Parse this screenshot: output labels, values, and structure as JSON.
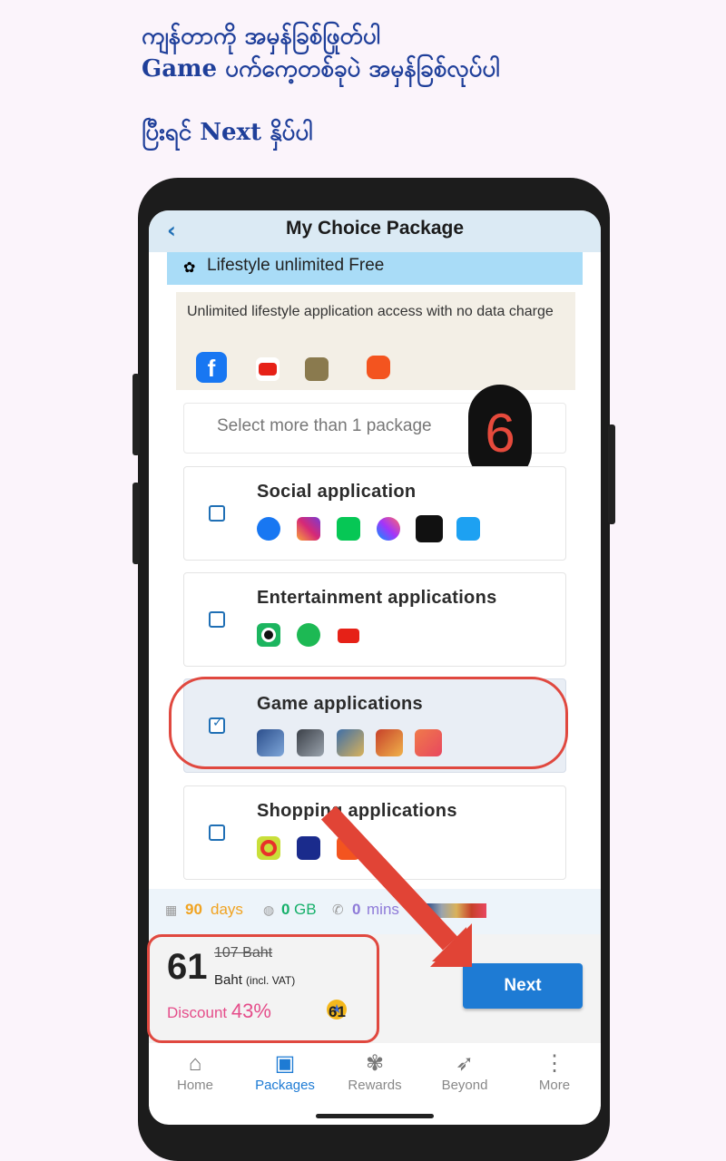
{
  "instructions": {
    "line1": "ကျန်တာကို အမှန်ခြစ်ဖြုတ်ပါ",
    "line2": "Game ပက်ကေ့တစ်ခုပဲ အမှန်ခြစ်လုပ်ပါ",
    "line3": "ပြီးရင် Next နှိပ်ပါ"
  },
  "header": {
    "back": "‹",
    "title": "My Choice Package"
  },
  "lifestyle": {
    "title": "Lifestyle unlimited Free",
    "description": "Unlimited lifestyle application access with no data charge",
    "apps": [
      "facebook-icon",
      "youtube-icon",
      "pubg-icon",
      "shopee-icon"
    ]
  },
  "select_hint": "Select more than 1 package",
  "step_badge": "6",
  "packages": [
    {
      "title": "Social application",
      "checked": false,
      "apps": [
        "facebook-icon",
        "instagram-icon",
        "line-icon",
        "messenger-icon",
        "tiktok-icon",
        "twitter-icon"
      ]
    },
    {
      "title": "Entertainment applications",
      "checked": false,
      "apps": [
        "joox-icon",
        "spotify-icon",
        "youtube-icon"
      ]
    },
    {
      "title": "Game applications",
      "checked": true,
      "apps": [
        "game1-icon",
        "codm-icon",
        "pubg-icon",
        "rov-icon",
        "game5-icon"
      ]
    },
    {
      "title": "Shopping applications",
      "checked": false,
      "apps": [
        "shopee-icon",
        "lazada-icon",
        "store-icon"
      ]
    }
  ],
  "stats": {
    "days": "90",
    "days_unit": "days",
    "data": "0",
    "data_unit": "GB",
    "mins": "0",
    "mins_unit": "mins"
  },
  "price": {
    "current": "61",
    "old": "107 Baht",
    "unit": "Baht",
    "vat": "(incl. VAT)",
    "discount_label": "Discount",
    "discount_value": "43%",
    "points": "61"
  },
  "next_label": "Next",
  "nav": [
    {
      "label": "Home",
      "icon": "home-icon",
      "active": false
    },
    {
      "label": "Packages",
      "icon": "box-icon",
      "active": true
    },
    {
      "label": "Rewards",
      "icon": "gift-icon",
      "active": false
    },
    {
      "label": "Beyond",
      "icon": "beyond-icon",
      "active": false
    },
    {
      "label": "More",
      "icon": "more-icon",
      "active": false
    }
  ],
  "colors": {
    "accent": "#1e7bd4",
    "annotation": "#e0483f",
    "discount": "#e54d8a"
  }
}
